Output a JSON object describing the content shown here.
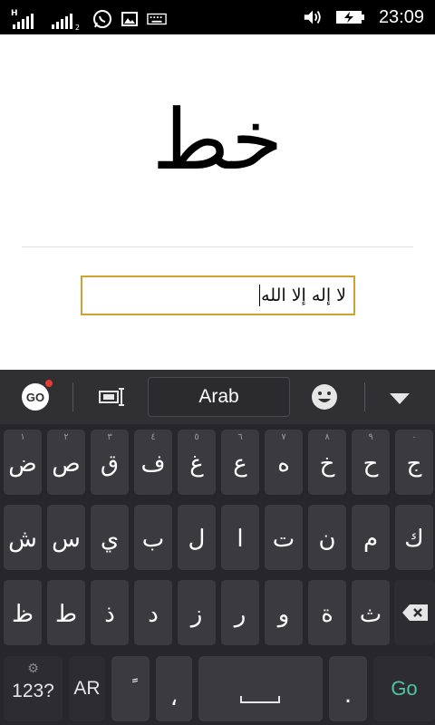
{
  "status_bar": {
    "time": "23:09",
    "sim1_type": "H",
    "sim2_number": "2",
    "icons": [
      "signal-icon",
      "signal-icon",
      "whatsapp-icon",
      "gallery-icon",
      "keyboard-icon",
      "volume-icon",
      "battery-charging-icon"
    ]
  },
  "main": {
    "calligraphy_text": "خط",
    "input_value": "لا إله إلا الله"
  },
  "keyboard": {
    "go_logo": "GO",
    "language_label": "Arab",
    "accent_color": "#4dc5a6",
    "row1": [
      {
        "char": "ض",
        "hint": "١"
      },
      {
        "char": "ص",
        "hint": "٢"
      },
      {
        "char": "ق",
        "hint": "٣"
      },
      {
        "char": "ف",
        "hint": "٤"
      },
      {
        "char": "غ",
        "hint": "٥"
      },
      {
        "char": "ع",
        "hint": "٦"
      },
      {
        "char": "ه",
        "hint": "٧"
      },
      {
        "char": "خ",
        "hint": "٨"
      },
      {
        "char": "ح",
        "hint": "٩"
      },
      {
        "char": "ج",
        "hint": "٠"
      }
    ],
    "row2": [
      "ش",
      "س",
      "ي",
      "ب",
      "ل",
      "ا",
      "ت",
      "ن",
      "م",
      "ك"
    ],
    "row3": [
      "ظ",
      "ط",
      "ذ",
      "د",
      "ز",
      "ر",
      "و",
      "ة",
      "ث"
    ],
    "bottom": {
      "numbers_label": "123?",
      "lang_switch_label": "AR",
      "tanween_char": "ً",
      "comma_char": "،",
      "period_char": ".",
      "go_label": "Go"
    }
  }
}
